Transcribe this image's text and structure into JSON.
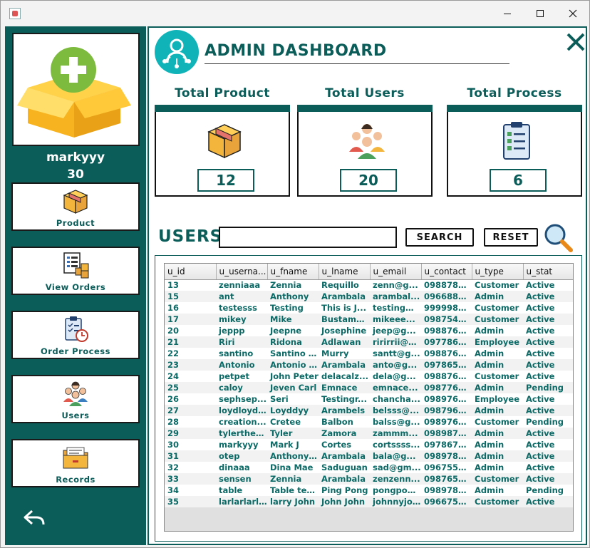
{
  "window": {
    "controls": {
      "minimize": "minimize",
      "maximize": "maximize",
      "close": "close"
    }
  },
  "sidebar": {
    "username": "markyyy",
    "age": "30",
    "nav": [
      {
        "label": "Product",
        "icon": "box-icon"
      },
      {
        "label": "View Orders",
        "icon": "orders-icon"
      },
      {
        "label": "Order Process",
        "icon": "clipboard-clock-icon"
      },
      {
        "label": "Users",
        "icon": "group-icon"
      },
      {
        "label": "Records",
        "icon": "folder-icon"
      }
    ]
  },
  "header": {
    "title": "ADMIN DASHBOARD"
  },
  "stats": [
    {
      "label": "Total Product",
      "value": "12",
      "icon": "box-icon"
    },
    {
      "label": "Total Users",
      "value": "20",
      "icon": "group-icon"
    },
    {
      "label": "Total Process",
      "value": "6",
      "icon": "checklist-icon"
    }
  ],
  "users_section": {
    "title": "USERS",
    "search_value": "",
    "search_button": "SEARCH",
    "reset_button": "RESET"
  },
  "colors": {
    "primary": "#0b5d5a",
    "accent": "#10b3b8"
  },
  "table": {
    "columns": [
      "u_id",
      "u_userna...",
      "u_fname",
      "u_lname",
      "u_email",
      "u_contact",
      "u_type",
      "u_stat"
    ],
    "rows": [
      [
        "13",
        "zenniaaa",
        "Zennia",
        "Requillo",
        "zenn@g...",
        "0988786...",
        "Customer",
        "Active"
      ],
      [
        "15",
        "ant",
        "Anthony",
        "Arambala",
        "arambal...",
        "0966886...",
        "Admin",
        "Active"
      ],
      [
        "16",
        "testesss",
        "Testing",
        "This is J...",
        "testing@...",
        "9999987...",
        "Customer",
        "Active"
      ],
      [
        "17",
        "mikey",
        "Mike",
        "Bustama...",
        "mikeee...",
        "0987543...",
        "Customer",
        "Active"
      ],
      [
        "20",
        "jeppp",
        "Jeepne",
        "Josephine",
        "jeep@g...",
        "0988765...",
        "Admin",
        "Active"
      ],
      [
        "21",
        "Riri",
        "Ridona",
        "Adlawan",
        "ririrrii@g...",
        "0977865...",
        "Employee",
        "Active"
      ],
      [
        "22",
        "santino",
        "Santino J...",
        "Murry",
        "santt@g...",
        "0988765...",
        "Admin",
        "Active"
      ],
      [
        "23",
        "Antonio",
        "Antonio L...",
        "Arambala",
        "anto@g...",
        "0978656...",
        "Admin",
        "Active"
      ],
      [
        "24",
        "petpet",
        "John Peter",
        "delacalz...",
        "dela@g...",
        "0988767...",
        "Customer",
        "Active"
      ],
      [
        "25",
        "caloy",
        "Jeven Carl",
        "Emnace",
        "emnace...",
        "0987765...",
        "Admin",
        "Pending"
      ],
      [
        "26",
        "sephsep...",
        "Seri",
        "Testingr...",
        "chancha...",
        "0989765...",
        "Employee",
        "Active"
      ],
      [
        "27",
        "loydloydl...",
        "Loyddyy",
        "Arambels",
        "belsss@...",
        "0987966...",
        "Admin",
        "Active"
      ],
      [
        "28",
        "creation...",
        "Cretee",
        "Balbon",
        "balss@g...",
        "0989765...",
        "Customer",
        "Pending"
      ],
      [
        "29",
        "tylerthed...",
        "Tyler",
        "Zamora",
        "zammm...",
        "0989876...",
        "Admin",
        "Active"
      ],
      [
        "30",
        "markyyy",
        "Mark J",
        "Cortes",
        "cortssss...",
        "0978678...",
        "Admin",
        "Active"
      ],
      [
        "31",
        "otep",
        "Anthony ...",
        "Arambala",
        "bala@g...",
        "0989786...",
        "Admin",
        "Active"
      ],
      [
        "32",
        "dinaaa",
        "Dina Mae",
        "Saduguan",
        "sad@gm...",
        "0967555...",
        "Admin",
        "Active"
      ],
      [
        "33",
        "sensen",
        "Zennia",
        "Arambala",
        "zenzenn...",
        "0987654...",
        "Customer",
        "Active"
      ],
      [
        "34",
        "table",
        "Table ten...",
        "Ping Pong",
        "pongpon...",
        "0989786...",
        "Admin",
        "Pending"
      ],
      [
        "35",
        "larlarlarlar",
        "larry John",
        "John John",
        "johnnyjo...",
        "0966754...",
        "Customer",
        "Active"
      ]
    ]
  }
}
